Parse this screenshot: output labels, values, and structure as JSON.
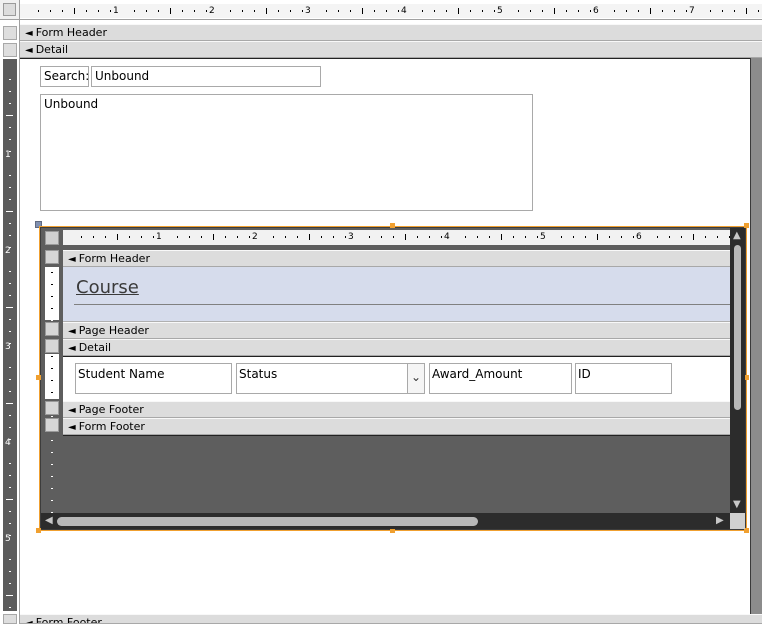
{
  "outer": {
    "sections": {
      "form_header": "Form Header",
      "detail": "Detail",
      "form_footer": "Form Footer"
    },
    "ruler_numbers": [
      "1",
      "2",
      "3",
      "4",
      "5",
      "6",
      "7"
    ],
    "vruler_numbers": [
      "1",
      "2",
      "3",
      "4",
      "5"
    ],
    "search_label": "Search:",
    "search_value": "Unbound",
    "memo_value": "Unbound"
  },
  "subform": {
    "ruler_numbers": [
      "1",
      "2",
      "3",
      "4",
      "5",
      "6"
    ],
    "sections": {
      "form_header": "Form Header",
      "page_header": "Page Header",
      "detail": "Detail",
      "page_footer": "Page Footer",
      "form_footer": "Form Footer"
    },
    "title": "Course",
    "fields": {
      "student_name": "Student Name",
      "status": "Status",
      "award_amount": "Award_Amount",
      "id": "ID"
    }
  },
  "colors": {
    "selection_border": "#f0a030",
    "section_bar": "#dcdcdc",
    "header_band": "#d6dcec",
    "canvas_dark": "#5e5e5e"
  }
}
